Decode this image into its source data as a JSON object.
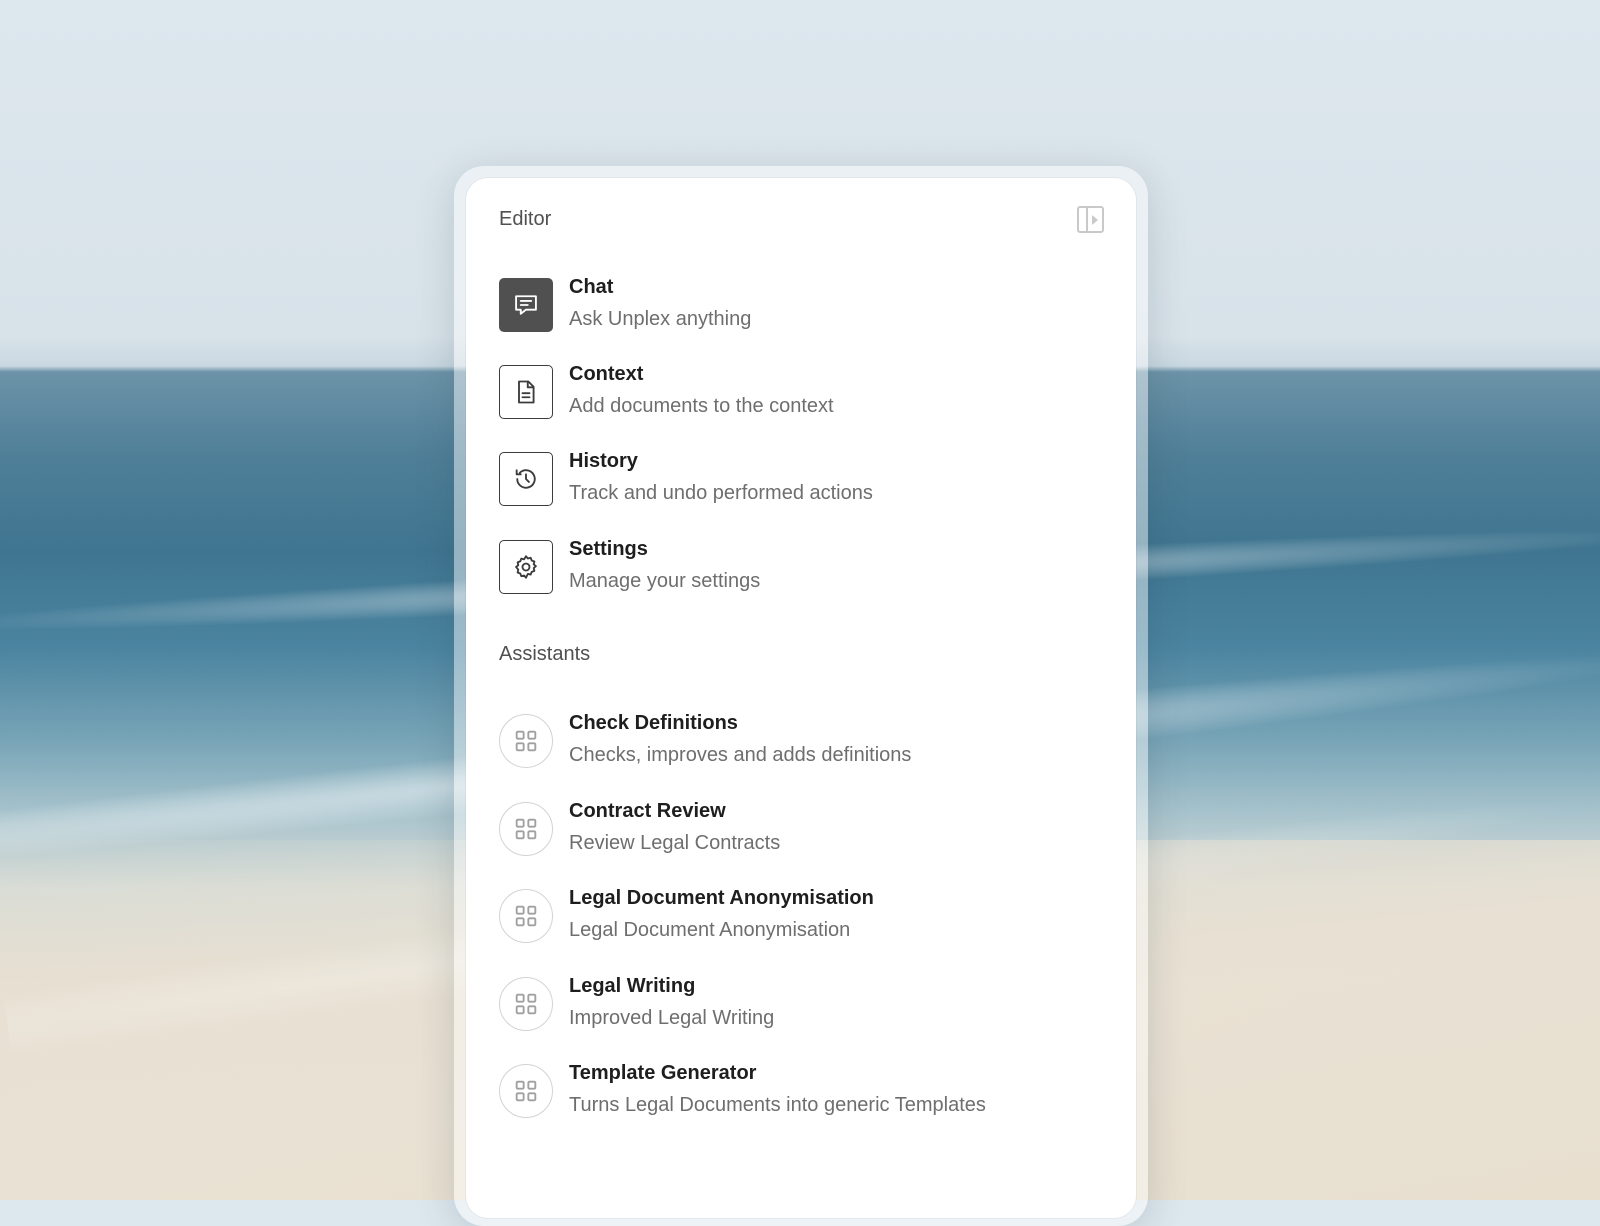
{
  "editor": {
    "title": "Editor",
    "collapse_icon": "sidebar-collapse-icon",
    "items": [
      {
        "label": "Chat",
        "description": "Ask Unplex anything",
        "icon": "chat-icon",
        "active": true
      },
      {
        "label": "Context",
        "description": "Add documents to the context",
        "icon": "document-icon",
        "active": false
      },
      {
        "label": "History",
        "description": "Track and undo performed actions",
        "icon": "history-icon",
        "active": false
      },
      {
        "label": "Settings",
        "description": "Manage your settings",
        "icon": "gear-icon",
        "active": false
      }
    ]
  },
  "assistants": {
    "title": "Assistants",
    "items": [
      {
        "label": "Check Definitions",
        "description": "Checks, improves and adds definitions",
        "icon": "grid-icon"
      },
      {
        "label": "Contract Review",
        "description": "Review Legal Contracts",
        "icon": "grid-icon"
      },
      {
        "label": "Legal Document Anonymisation",
        "description": "Legal Document Anonymisation",
        "icon": "grid-icon"
      },
      {
        "label": "Legal Writing",
        "description": "Improved Legal Writing",
        "icon": "grid-icon"
      },
      {
        "label": "Template Generator",
        "description": "Turns Legal Documents into generic Templates",
        "icon": "grid-icon"
      }
    ]
  },
  "colors": {
    "active_icon_bg": "#505050",
    "panel_bg": "#ffffff",
    "label_text": "#1e1e1e",
    "description_text": "#6e6e6e"
  }
}
